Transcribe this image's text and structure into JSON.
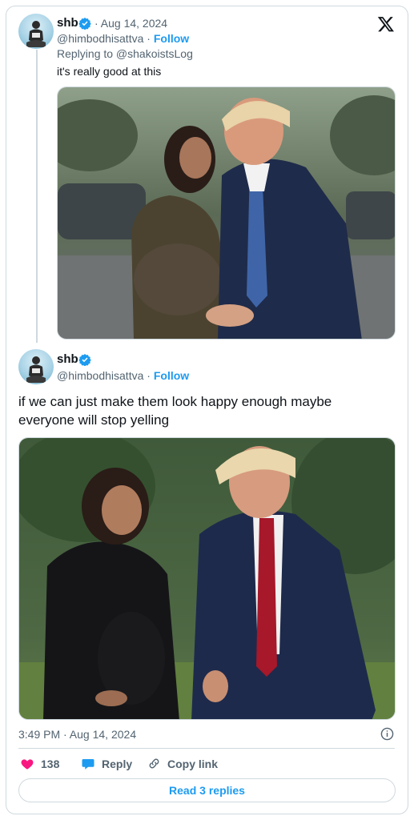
{
  "reply_tweet": {
    "display_name": "shb",
    "handle": "@himbodhisattva",
    "date": "Aug 14, 2024",
    "follow_label": "Follow",
    "replying_to": "Replying to @shakoistsLog",
    "text": "it's really good at this"
  },
  "main_tweet": {
    "display_name": "shb",
    "handle": "@himbodhisattva",
    "follow_label": "Follow",
    "text": "if we can just make them look happy enough maybe everyone will stop yelling",
    "timestamp": "3:49 PM · Aug 14, 2024"
  },
  "actions": {
    "likes": "138",
    "reply_label": "Reply",
    "copy_link_label": "Copy link"
  },
  "read_replies_label": "Read 3 replies",
  "colors": {
    "accent": "#1d9bf0",
    "heart": "#f91880",
    "muted": "#536471",
    "border": "#cfd9de"
  }
}
